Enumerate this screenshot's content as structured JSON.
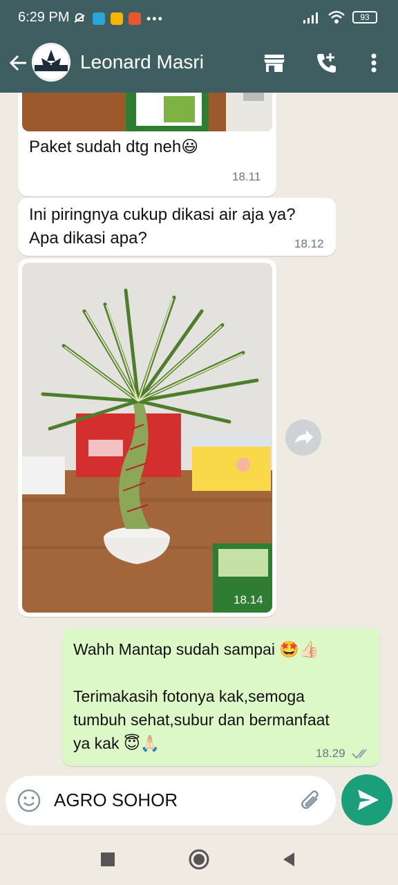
{
  "status_bar": {
    "time": "6:29 PM",
    "battery": "93"
  },
  "header": {
    "contact_name": "Leonard Masri",
    "avatar_text": "UROLINE AUT"
  },
  "messages": [
    {
      "text": "Paket sudah dtg neh😃",
      "time": "18.11",
      "direction": "in"
    },
    {
      "text": "Ini piringnya cukup dikasi air aja ya?\nApa dikasi apa?",
      "time": "18.12",
      "direction": "in"
    },
    {
      "text": "",
      "time": "18.14",
      "direction": "in",
      "type": "image"
    },
    {
      "text": "Wahh Mantap sudah sampai 🤩👍🏻\n\nTerimakasih fotonya kak,semoga\ntumbuh sehat,subur dan bermanfaat\nya kak 😇🙏🏻",
      "time": "18.29",
      "direction": "out"
    }
  ],
  "composer": {
    "value": "AGRO SOHOR"
  },
  "colors": {
    "header": "#3f5e61",
    "outgoing_bubble": "#dcf8c6",
    "send_button": "#1b9e7a",
    "chat_bg": "#efeae2"
  }
}
